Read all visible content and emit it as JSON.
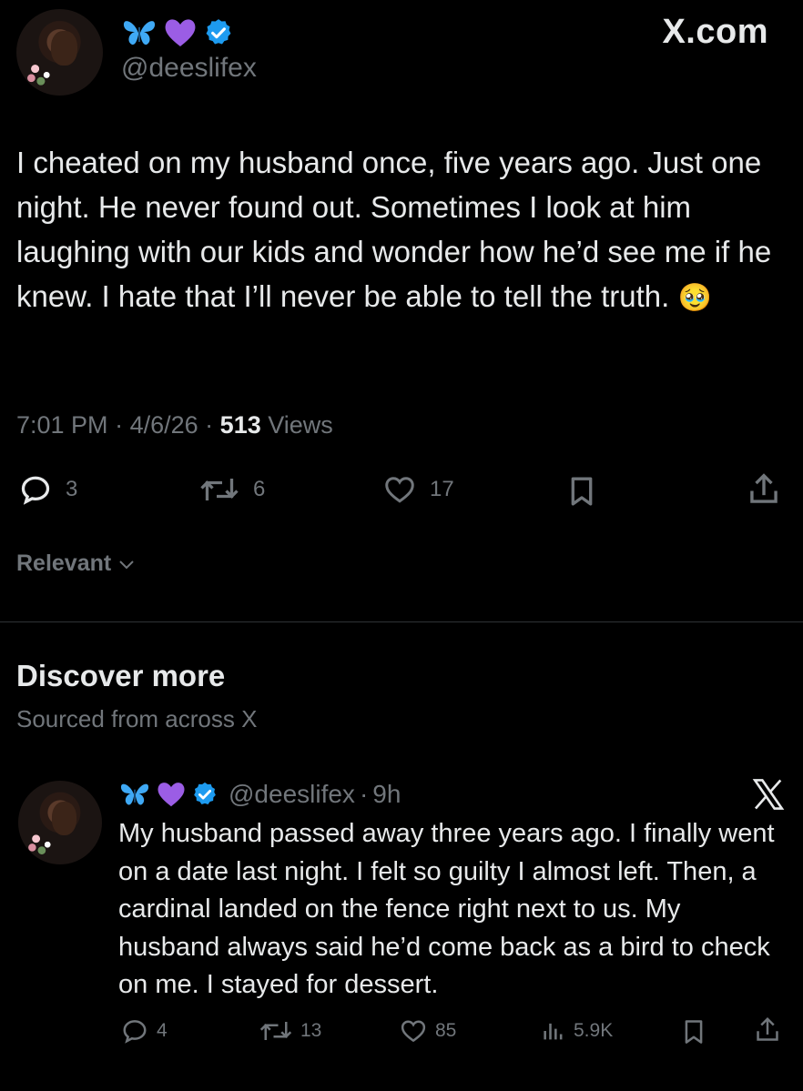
{
  "header": {
    "handle": "@deeslifex",
    "brand": "X.com",
    "icons": [
      "butterfly-icon",
      "purple-heart-icon",
      "verified-badge-icon"
    ]
  },
  "post": {
    "text": "I cheated on my husband once, five years ago. Just one night. He never found out. Sometimes I look at him laughing with our kids and wonder how he’d see me if he knew. I hate that I’ll never be able to tell the truth.",
    "emoji": "🥹",
    "time": "7:01 PM",
    "date": "4/6/26",
    "views_count": "513",
    "views_label": "Views",
    "replies": "3",
    "reposts": "6",
    "likes": "17"
  },
  "sort": {
    "label": "Relevant"
  },
  "discover": {
    "title": "Discover more",
    "subtitle": "Sourced from across X"
  },
  "second_post": {
    "handle": "@deeslifex",
    "time": "9h",
    "text": "My husband passed away three years ago. I finally went on a date last night. I felt so guilty I almost left. Then, a cardinal landed on the fence right next to us. My husband always said he’d come back as a bird to check on me. I stayed for dessert.",
    "replies": "4",
    "reposts": "13",
    "likes": "85",
    "views": "5.9K"
  },
  "colors": {
    "background": "#000000",
    "text": "#e7e9ea",
    "muted": "#71767b",
    "verified": "#1d9bf0",
    "butterfly": "#3fa9f5",
    "heart": "#9b5de5"
  }
}
